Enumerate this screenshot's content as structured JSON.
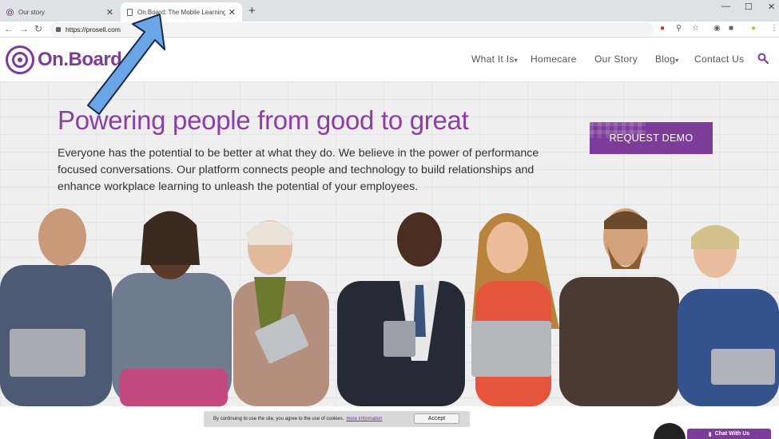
{
  "browser": {
    "tabs": [
      {
        "title": "Our story"
      },
      {
        "title": "On.Board: The Mobile Learning a"
      }
    ],
    "new_tab": "+",
    "window_controls": {
      "minimize": "—",
      "maximize": "☐",
      "close": "✕"
    },
    "nav": {
      "back": "←",
      "forward": "→",
      "reload": "↻"
    },
    "url": "https://prosell.com"
  },
  "site": {
    "logo_text": "On.Board",
    "nav": [
      {
        "label": "What It Is",
        "caret": "▾"
      },
      {
        "label": "Homecare"
      },
      {
        "label": "Our Story"
      },
      {
        "label": "Blog",
        "caret": "▾"
      },
      {
        "label": "Contact Us"
      }
    ],
    "brand_color": "#7d3c98"
  },
  "hero": {
    "title": "Powering people from good to great",
    "text": "Everyone has the potential to be better at what they do. We believe in the power of performance focused conversations. Our platform connects people and technology to build relationships and enhance workplace learning to unleash the potential of your employees.",
    "cta": "REQUEST DEMO"
  },
  "cookie": {
    "text": "By continuing to use the site, you agree to the use of cookies.",
    "link": "more information",
    "accept": "Accept"
  },
  "chat": {
    "label": "Chat With Us"
  }
}
